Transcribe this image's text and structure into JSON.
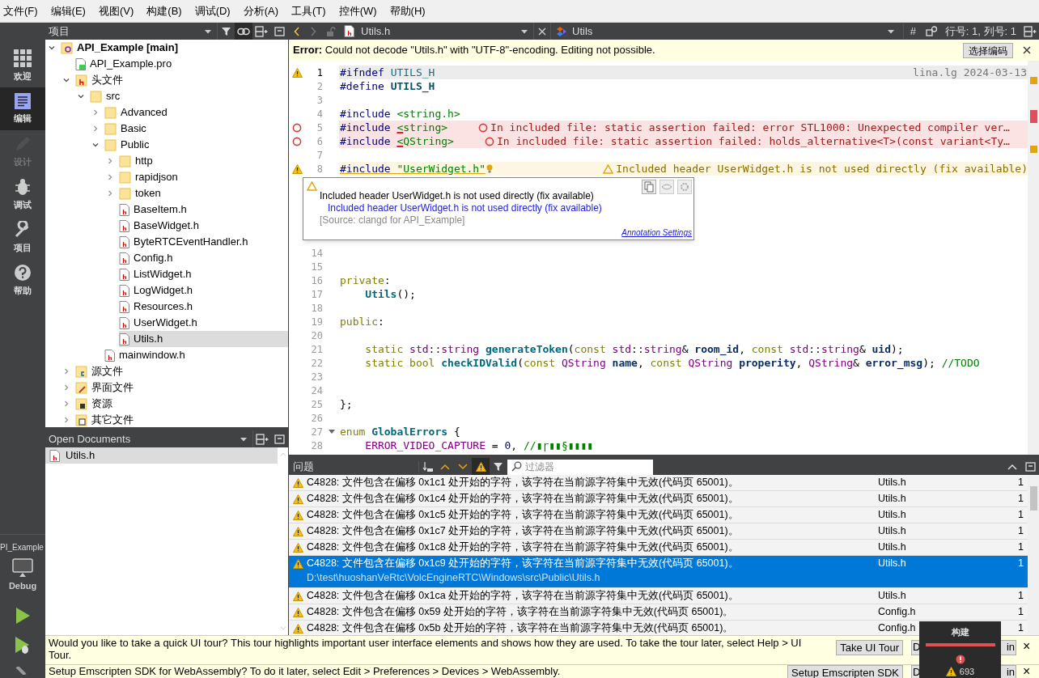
{
  "menu": [
    "文件(F)",
    "编辑(E)",
    "视图(V)",
    "构建(B)",
    "调试(D)",
    "分析(A)",
    "工具(T)",
    "控件(W)",
    "帮助(H)"
  ],
  "modes": [
    {
      "label": "欢迎",
      "kind": "welcome",
      "selected": false,
      "disabled": false
    },
    {
      "label": "编辑",
      "kind": "edit",
      "selected": true,
      "disabled": false
    },
    {
      "label": "设计",
      "kind": "design",
      "selected": false,
      "disabled": true
    },
    {
      "label": "调试",
      "kind": "debug",
      "selected": false,
      "disabled": false
    },
    {
      "label": "项目",
      "kind": "projects",
      "selected": false,
      "disabled": false
    },
    {
      "label": "帮助",
      "kind": "help",
      "selected": false,
      "disabled": false
    }
  ],
  "target": {
    "project": "PI_Example",
    "config": "Debug"
  },
  "project_pane": {
    "title": "项目",
    "tree": [
      {
        "label": "API_Example [main]",
        "kind": "project",
        "expanded": true,
        "selected": false,
        "children": [
          {
            "label": "API_Example.pro",
            "kind": "pro",
            "selected": false
          },
          {
            "label": "头文件",
            "kind": "headers",
            "expanded": true,
            "selected": false,
            "children": [
              {
                "label": "src",
                "kind": "folder",
                "expanded": true,
                "selected": false,
                "children": [
                  {
                    "label": "Advanced",
                    "kind": "folder",
                    "expanded": false,
                    "selected": false
                  },
                  {
                    "label": "Basic",
                    "kind": "folder",
                    "expanded": false,
                    "selected": false
                  },
                  {
                    "label": "Public",
                    "kind": "folder",
                    "expanded": true,
                    "selected": false,
                    "children": [
                      {
                        "label": "http",
                        "kind": "folder",
                        "expanded": false,
                        "selected": false
                      },
                      {
                        "label": "rapidjson",
                        "kind": "folder",
                        "expanded": false,
                        "selected": false
                      },
                      {
                        "label": "token",
                        "kind": "folder",
                        "expanded": false,
                        "selected": false
                      },
                      {
                        "label": "BaseItem.h",
                        "kind": "header",
                        "selected": false
                      },
                      {
                        "label": "BaseWidget.h",
                        "kind": "header",
                        "selected": false
                      },
                      {
                        "label": "ByteRTCEventHandler.h",
                        "kind": "header",
                        "selected": false
                      },
                      {
                        "label": "Config.h",
                        "kind": "header",
                        "selected": false
                      },
                      {
                        "label": "ListWidget.h",
                        "kind": "header",
                        "selected": false
                      },
                      {
                        "label": "LogWidget.h",
                        "kind": "header",
                        "selected": false
                      },
                      {
                        "label": "Resources.h",
                        "kind": "header",
                        "selected": false
                      },
                      {
                        "label": "UserWidget.h",
                        "kind": "header",
                        "selected": false
                      },
                      {
                        "label": "Utils.h",
                        "kind": "header",
                        "selected": true
                      }
                    ]
                  },
                  {
                    "label": "mainwindow.h",
                    "kind": "header",
                    "selected": false
                  }
                ]
              }
            ]
          },
          {
            "label": "源文件",
            "kind": "sources",
            "expanded": false,
            "selected": false
          },
          {
            "label": "界面文件",
            "kind": "forms",
            "expanded": false,
            "selected": false
          },
          {
            "label": "资源",
            "kind": "resources",
            "expanded": false,
            "selected": false
          },
          {
            "label": "其它文件",
            "kind": "other",
            "expanded": false,
            "selected": false
          }
        ]
      }
    ]
  },
  "open_documents": {
    "title": "Open Documents",
    "items": [
      {
        "label": "Utils.h",
        "selected": true
      }
    ]
  },
  "editor": {
    "file": "Utils.h",
    "symbol": "Utils",
    "hash": "#",
    "position": "行号: 1, 列号: 1",
    "error_bar": {
      "label": "Error:",
      "message": "Could not decode \"Utils.h\" with \"UTF-8\"-encoding. Editing not possible.",
      "button": "选择编码"
    },
    "lines": [
      {
        "n": "1",
        "warning": true,
        "current": true,
        "tokens": [
          {
            "kind": "pp",
            "text": "#ifndef "
          },
          {
            "kind": "mac",
            "text": "UTILS_H"
          }
        ],
        "blame": "lina.lg 2024-03-13"
      },
      {
        "n": "2",
        "tokens": [
          {
            "kind": "pp",
            "text": "#define "
          },
          {
            "kind": "macb",
            "text": "UTILS_H"
          }
        ]
      },
      {
        "n": "3"
      },
      {
        "n": "4",
        "tokens": [
          {
            "kind": "pp",
            "text": "#include "
          },
          {
            "kind": "inc",
            "text": "<string.h>"
          }
        ]
      },
      {
        "n": "5",
        "error": true,
        "tokens": [
          {
            "kind": "pp",
            "text": "#include "
          },
          {
            "kind": "err",
            "text": "<"
          },
          {
            "kind": "inc",
            "text": "string>"
          }
        ],
        "annotation": {
          "kind": "error",
          "text": "In included file: static assertion failed: error STL1000: Unexpected compiler ver…"
        }
      },
      {
        "n": "6",
        "error": true,
        "tokens": [
          {
            "kind": "pp",
            "text": "#include "
          },
          {
            "kind": "err",
            "text": "<"
          },
          {
            "kind": "inc",
            "text": "QString>"
          }
        ],
        "annotation": {
          "kind": "error",
          "text": "In included file: static assertion failed: holds_alternative<T>(const variant<Ty…"
        }
      },
      {
        "n": "7"
      },
      {
        "n": "8",
        "warning": true,
        "bulb": true,
        "tokens": [
          {
            "kind": "wpp",
            "text": "#include "
          },
          {
            "kind": "winc",
            "text": "\"UserWidget.h\""
          }
        ],
        "annotation": {
          "kind": "warning",
          "text": "Included header UserWidget.h is not used directly (fix available)"
        }
      },
      {
        "n": "14"
      },
      {
        "n": "15"
      },
      {
        "n": "16",
        "tokens": [
          {
            "kind": "kw",
            "text": "private"
          },
          {
            "kind": "plain",
            "text": ":"
          }
        ]
      },
      {
        "n": "17",
        "tokens": [
          {
            "kind": "fnb",
            "text": "    Utils"
          },
          {
            "kind": "plain",
            "text": "();"
          }
        ]
      },
      {
        "n": "18"
      },
      {
        "n": "19",
        "tokens": [
          {
            "kind": "kw",
            "text": "public"
          },
          {
            "kind": "plain",
            "text": ":"
          }
        ]
      },
      {
        "n": "20"
      },
      {
        "n": "21",
        "tokens": [
          {
            "kind": "kw",
            "text": "    static "
          },
          {
            "kind": "type",
            "text": "std"
          },
          {
            "kind": "plain",
            "text": "::"
          },
          {
            "kind": "type",
            "text": "string "
          },
          {
            "kind": "fnb",
            "text": "generateToken"
          },
          {
            "kind": "plain",
            "text": "("
          },
          {
            "kind": "kw",
            "text": "const "
          },
          {
            "kind": "type",
            "text": "std"
          },
          {
            "kind": "plain",
            "text": "::"
          },
          {
            "kind": "type",
            "text": "string"
          },
          {
            "kind": "plain",
            "text": "& "
          },
          {
            "kind": "argb",
            "text": "room_id"
          },
          {
            "kind": "plain",
            "text": ", "
          },
          {
            "kind": "kw",
            "text": "const "
          },
          {
            "kind": "type",
            "text": "std"
          },
          {
            "kind": "plain",
            "text": "::"
          },
          {
            "kind": "type",
            "text": "string"
          },
          {
            "kind": "plain",
            "text": "& "
          },
          {
            "kind": "argb",
            "text": "uid"
          },
          {
            "kind": "plain",
            "text": ");"
          }
        ]
      },
      {
        "n": "22",
        "tokens": [
          {
            "kind": "kw",
            "text": "    static bool "
          },
          {
            "kind": "fnb",
            "text": "checkIDValid"
          },
          {
            "kind": "plain",
            "text": "("
          },
          {
            "kind": "kw",
            "text": "const "
          },
          {
            "kind": "type",
            "text": "QString "
          },
          {
            "kind": "argb",
            "text": "name"
          },
          {
            "kind": "plain",
            "text": ", "
          },
          {
            "kind": "kw",
            "text": "const "
          },
          {
            "kind": "type",
            "text": "QString "
          },
          {
            "kind": "argb",
            "text": "properity"
          },
          {
            "kind": "plain",
            "text": ", "
          },
          {
            "kind": "type",
            "text": "QString"
          },
          {
            "kind": "plain",
            "text": "& "
          },
          {
            "kind": "argb",
            "text": "error_msg"
          },
          {
            "kind": "plain",
            "text": "); "
          },
          {
            "kind": "cm",
            "text": "//TODO"
          }
        ]
      },
      {
        "n": "23"
      },
      {
        "n": "24"
      },
      {
        "n": "25",
        "tokens": [
          {
            "kind": "plain",
            "text": "};"
          }
        ]
      },
      {
        "n": "26"
      },
      {
        "n": "27",
        "fold": true,
        "tokens": [
          {
            "kind": "kw",
            "text": "enum "
          },
          {
            "kind": "enumb",
            "text": "GlobalErrors"
          },
          {
            "kind": "plain",
            "text": " {"
          }
        ]
      },
      {
        "n": "28",
        "tokens": [
          {
            "kind": "enumv",
            "text": "    ERROR_VIDEO_CAPTURE"
          },
          {
            "kind": "plain",
            "text": " = "
          },
          {
            "kind": "num",
            "text": "0"
          },
          {
            "kind": "plain",
            "text": ", "
          },
          {
            "kind": "cm",
            "text": "//▮ɼ▮▮§▮▮▮▮"
          }
        ]
      }
    ],
    "tooltip": {
      "title": "Included header UserWidget.h is not used directly (fix available)",
      "detail": "Included header UserWidget.h is not used directly (fix available)",
      "source": "[Source: clangd for API_Example]",
      "link": "Annotation Settings"
    }
  },
  "issues": {
    "title": "问题",
    "filter_placeholder": "过滤器",
    "rows": [
      {
        "text": "C4828: 文件包含在偏移 0x1c1 处开始的字符，该字符在当前源字符集中无效(代码页 65001)。",
        "file": "Utils.h",
        "line": "1",
        "selected": false
      },
      {
        "text": "C4828: 文件包含在偏移 0x1c4 处开始的字符，该字符在当前源字符集中无效(代码页 65001)。",
        "file": "Utils.h",
        "line": "1",
        "selected": false
      },
      {
        "text": "C4828: 文件包含在偏移 0x1c5 处开始的字符，该字符在当前源字符集中无效(代码页 65001)。",
        "file": "Utils.h",
        "line": "1",
        "selected": false
      },
      {
        "text": "C4828: 文件包含在偏移 0x1c7 处开始的字符，该字符在当前源字符集中无效(代码页 65001)。",
        "file": "Utils.h",
        "line": "1",
        "selected": false
      },
      {
        "text": "C4828: 文件包含在偏移 0x1c8 处开始的字符，该字符在当前源字符集中无效(代码页 65001)。",
        "file": "Utils.h",
        "line": "1",
        "selected": false
      },
      {
        "text": "C4828: 文件包含在偏移 0x1c9 处开始的字符，该字符在当前源字符集中无效(代码页 65001)。",
        "path": "D:\\test\\huoshanVeRtc\\VolcEngineRTC\\Windows\\src\\Public\\Utils.h",
        "file": "Utils.h",
        "line": "1",
        "selected": true
      },
      {
        "text": "C4828: 文件包含在偏移 0x1ca 处开始的字符，该字符在当前源字符集中无效(代码页 65001)。",
        "file": "Utils.h",
        "line": "1",
        "selected": false
      },
      {
        "text": "C4828: 文件包含在偏移 0x59 处开始的字符，该字符在当前源字符集中无效(代码页 65001)。",
        "file": "Config.h",
        "line": "1",
        "selected": false
      },
      {
        "text": "C4828: 文件包含在偏移 0x5b 处开始的字符，该字符在当前源字符集中无效(代码页 65001)。",
        "file": "Config.h",
        "line": "1",
        "selected": false
      }
    ]
  },
  "info_bars": [
    {
      "text": "Would you like to take a quick UI tour? This tour highlights important user interface elements and shows how they are used. To take the tour later, select Help > UI Tour.",
      "button": "Take UI Tour",
      "second_button": [
        "D",
        "in"
      ],
      "close": "×"
    },
    {
      "text": "Setup Emscripten SDK for WebAssembly? To do it later, select Edit > Preferences > Devices > WebAssembly.",
      "button": "Setup Emscripten SDK",
      "second_button": [
        "D",
        "in"
      ],
      "close": "×"
    }
  ],
  "build_popup": {
    "title": "构建",
    "level": 1,
    "warnings": "693"
  }
}
